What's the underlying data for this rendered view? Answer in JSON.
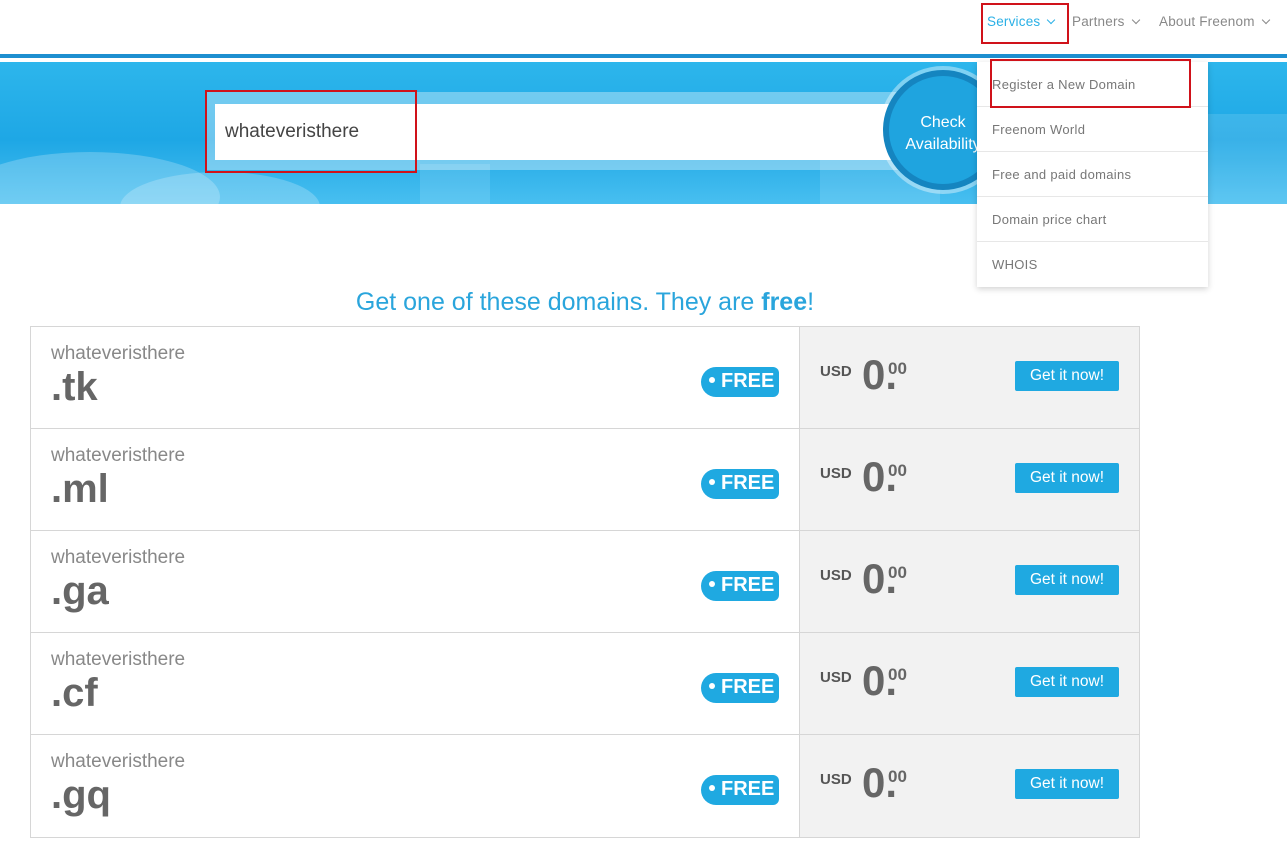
{
  "nav": {
    "services": "Services",
    "partners": "Partners",
    "about": "About Freenom"
  },
  "search": {
    "value": "whateveristhere",
    "check_line1": "Check",
    "check_line2": "Availability"
  },
  "dropdown": {
    "items": [
      "Register a New Domain",
      "Freenom World",
      "Free and paid domains",
      "Domain price chart",
      "WHOIS"
    ]
  },
  "headline": {
    "before": "Get one of these domains. They are ",
    "bold": "free",
    "after": "!"
  },
  "domains": [
    {
      "name": "whateveristhere",
      "tld": ".tk",
      "badge": "FREE",
      "currency": "USD",
      "amount": "0.",
      "cents": "00",
      "button": "Get it now!"
    },
    {
      "name": "whateveristhere",
      "tld": ".ml",
      "badge": "FREE",
      "currency": "USD",
      "amount": "0.",
      "cents": "00",
      "button": "Get it now!"
    },
    {
      "name": "whateveristhere",
      "tld": ".ga",
      "badge": "FREE",
      "currency": "USD",
      "amount": "0.",
      "cents": "00",
      "button": "Get it now!"
    },
    {
      "name": "whateveristhere",
      "tld": ".cf",
      "badge": "FREE",
      "currency": "USD",
      "amount": "0.",
      "cents": "00",
      "button": "Get it now!"
    },
    {
      "name": "whateveristhere",
      "tld": ".gq",
      "badge": "FREE",
      "currency": "USD",
      "amount": "0.",
      "cents": "00",
      "button": "Get it now!"
    }
  ],
  "colors": {
    "accent": "#1fa9e1",
    "highlight_box": "#d0121a",
    "hero": "#1ea7e5"
  }
}
